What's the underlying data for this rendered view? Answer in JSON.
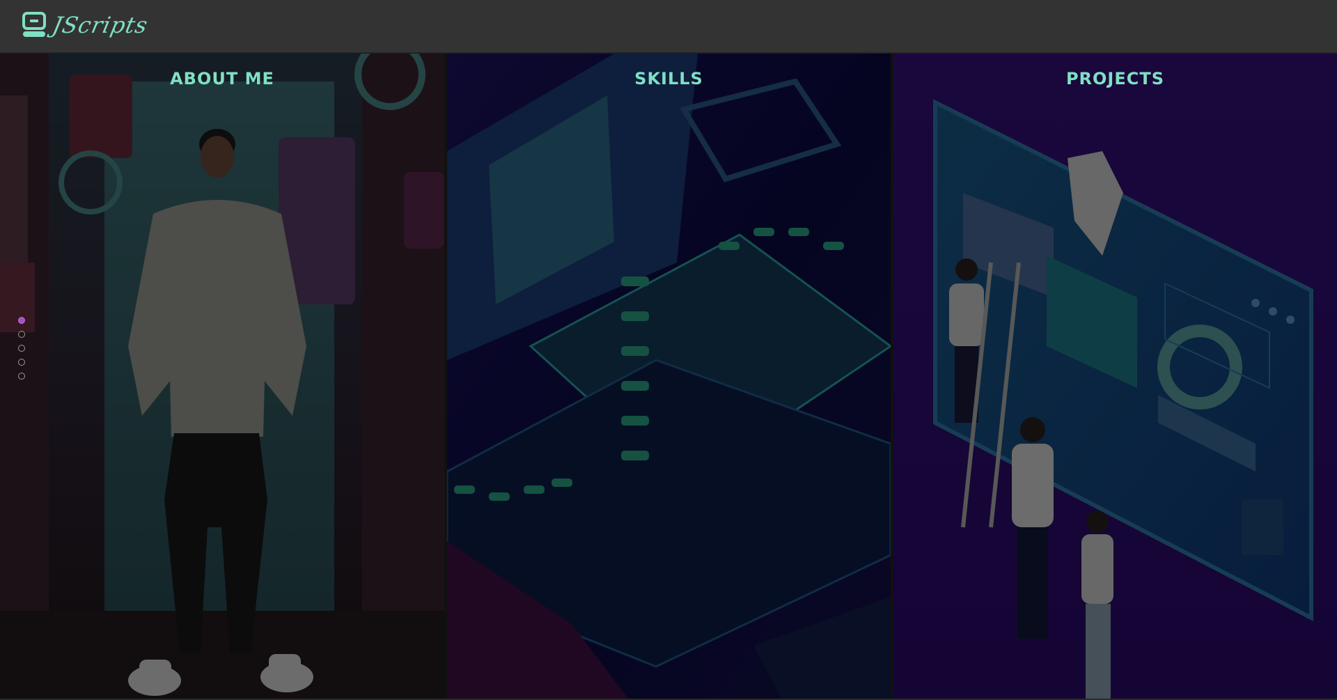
{
  "header": {
    "logo_text": "JScripts",
    "logo_icon": "computer-icon",
    "accent_color": "#7fe0c4",
    "background_color": "#333333"
  },
  "panels": [
    {
      "title": "ABOUT ME",
      "art": "person-standing-neon-wall"
    },
    {
      "title": "SKILLS",
      "art": "isometric-keyboard-devices"
    },
    {
      "title": "PROJECTS",
      "art": "team-building-webpage"
    }
  ],
  "pagination": {
    "count": 5,
    "active_index": 0,
    "active_color": "#a94ec4"
  }
}
